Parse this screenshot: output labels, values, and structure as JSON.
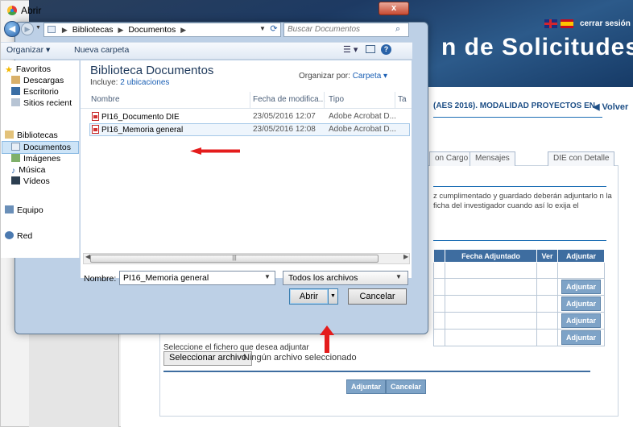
{
  "background": {
    "banner_title": "n de Solicitudes",
    "logout": "cerrar sesión",
    "section_title": "(AES 2016). MODALIDAD PROYECTOS EN",
    "back_link": "◀ Volver",
    "tabs": [
      "on Cargo",
      "Mensajes",
      "DIE con Detalle"
    ],
    "instructions": "z cumplimentado y guardado deberán adjuntarlo n la ficha del investigador cuando así lo exija el",
    "table_headers": [
      "Fecha Adjuntado",
      "Ver",
      "Adjuntar"
    ],
    "attach_label": "Adjuntar",
    "file_prompt": "Seleccione el fichero que desea adjuntar",
    "choose_file": "Seleccionar archivo",
    "no_file": "Ningún archivo seleccionado",
    "attach_main": "Adjuntar",
    "cancel_main": "Cancelar",
    "colors": {
      "banner": "#1d3a63",
      "accent": "#3e6da0",
      "button": "#7ea3c7"
    }
  },
  "dialog": {
    "title": "Abrir",
    "close": "x",
    "breadcrumb": [
      "Bibliotecas",
      "Documentos"
    ],
    "search_placeholder": "Buscar Documentos",
    "toolbar": {
      "organize": "Organizar ▾",
      "new_folder": "Nueva carpeta"
    },
    "nav": {
      "favorites": "Favoritos",
      "downloads": "Descargas",
      "desktop": "Escritorio",
      "recent": "Sitios recient",
      "libraries": "Bibliotecas",
      "documents": "Documentos",
      "images": "Imágenes",
      "music": "Música",
      "videos": "Vídeos",
      "computer": "Equipo",
      "network": "Red"
    },
    "library_title": "Biblioteca Documentos",
    "includes_prefix": "Incluye:",
    "includes_link": "2 ubicaciones",
    "arrange_label": "Organizar por:",
    "arrange_value": "Carpeta ▾",
    "columns": [
      "Nombre",
      "Fecha de modifica...",
      "Tipo",
      "Ta"
    ],
    "files": [
      {
        "name": "PI16_Documento DIE",
        "date": "23/05/2016 12:07",
        "type": "Adobe Acrobat D..."
      },
      {
        "name": "PI16_Memoria general",
        "date": "23/05/2016 12:08",
        "type": "Adobe Acrobat D..."
      }
    ],
    "filename_label": "Nombre:",
    "filename_value": "PI16_Memoria general",
    "filetype_value": "Todos los archivos",
    "open": "Abrir",
    "cancel": "Cancelar"
  }
}
